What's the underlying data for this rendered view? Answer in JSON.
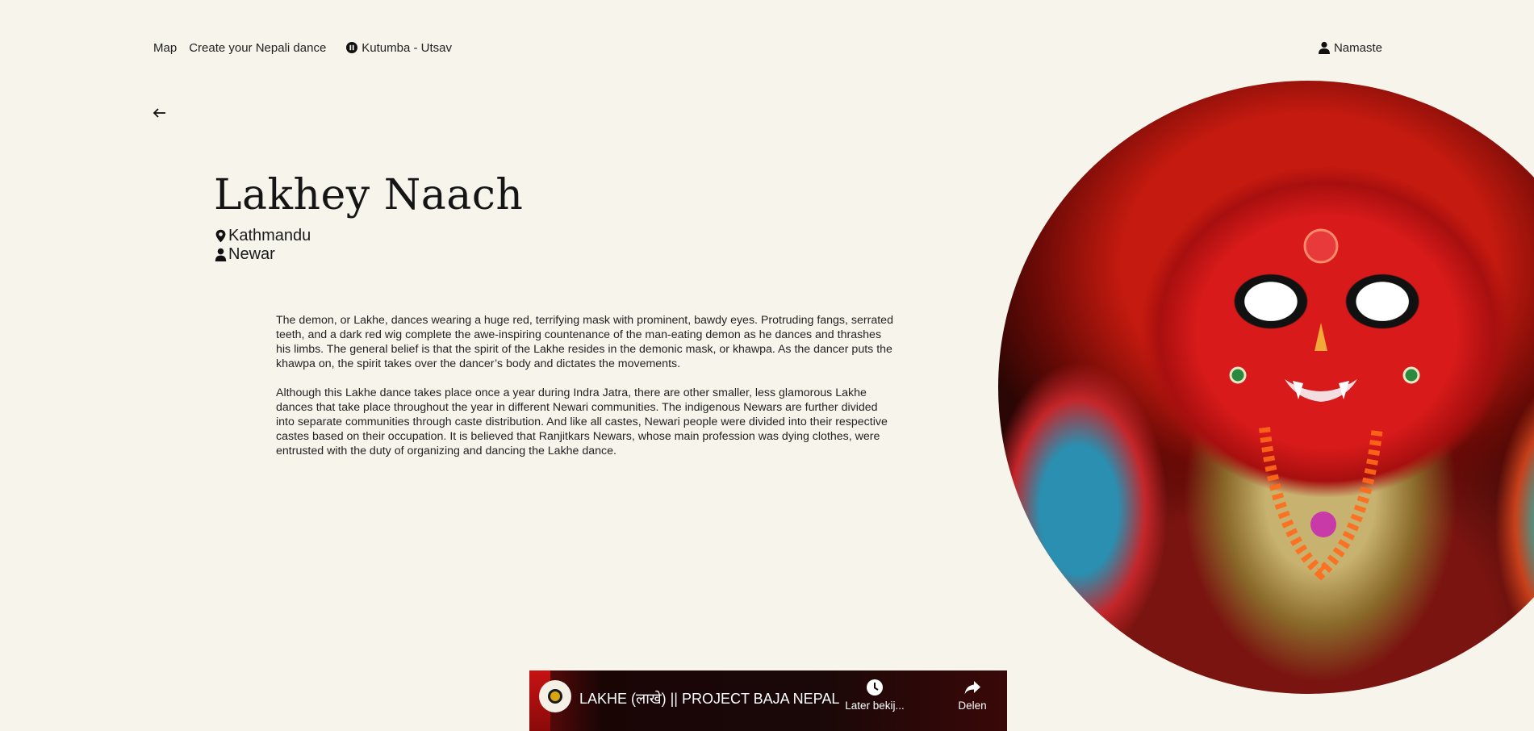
{
  "nav": {
    "map_label": "Map",
    "create_label": "Create your Nepali dance",
    "player_label": "Kutumba - Utsav",
    "user_label": "Namaste"
  },
  "dance": {
    "title": "Lakhey Naach",
    "location": "Kathmandu",
    "group": "Newar",
    "paragraphs": [
      "The demon, or Lakhe, dances wearing a huge red, terrifying mask with prominent, bawdy eyes. Protruding fangs, serrated teeth, and a dark red wig complete the awe-inspiring countenance of the man-eating demon as he dances and thrashes his limbs. The general belief is that the spirit of the Lakhe resides in the demonic mask, or khawpa. As the dancer puts the khawpa on, the spirit takes over the dancer’s body and dictates the movements.",
      "Although this Lakhe dance takes place once a year during Indra Jatra, there are other smaller, less glamorous Lakhe dances that take place throughout the year in different Newari communities. The indigenous Newars are further divided into separate communities through caste distribution. And like all castes, Newari people were divided into their respective castes based on their occupation. It is believed that Ranjitkars Newars, whose main profession was dying clothes, were entrusted with the duty of organizing and dancing the Lakhe dance."
    ]
  },
  "video": {
    "title": "LAKHE (लाखे) || PROJECT BAJA NEPAL",
    "watch_later_label": "Later bekij...",
    "share_label": "Delen"
  },
  "icons": {
    "player": "pause-circle-icon",
    "user": "user-icon",
    "back": "arrow-left-icon",
    "location": "map-pin-icon",
    "group": "person-icon",
    "watch_later": "clock-icon",
    "share": "share-arrow-icon"
  },
  "colors": {
    "background": "#f7f4ec",
    "text": "#1c1c1c"
  }
}
